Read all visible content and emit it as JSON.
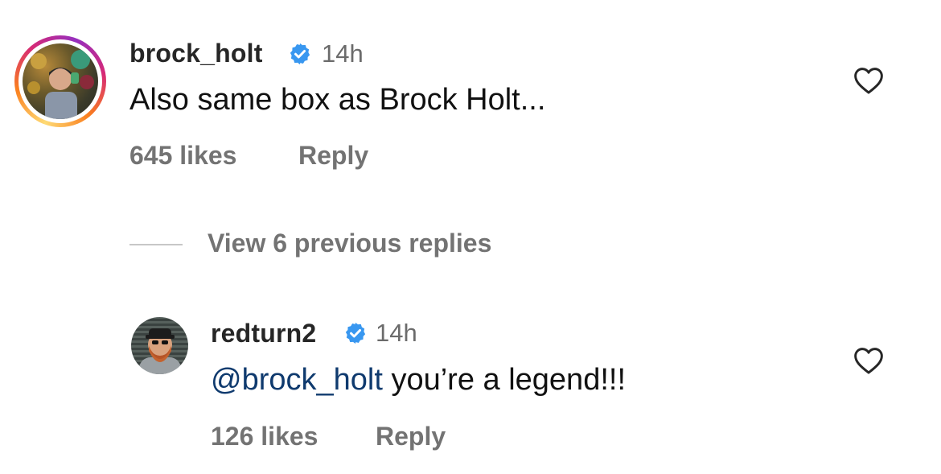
{
  "comments": [
    {
      "username": "brock_holt",
      "verified": true,
      "time": "14h",
      "text": "Also same box as Brock Holt...",
      "likes": "645 likes",
      "reply_label": "Reply",
      "avatar_ring": true
    },
    {
      "username": "redturn2",
      "verified": true,
      "time": "14h",
      "mention": "@brock_holt",
      "text": " you’re a legend!!!",
      "likes": "126 likes",
      "reply_label": "Reply",
      "avatar_ring": false
    }
  ],
  "thread": {
    "view_replies_label": "View 6 previous replies"
  },
  "icons": {
    "verified": "verified-badge-icon",
    "like": "heart-outline-icon"
  },
  "colors": {
    "verified_blue": "#3897f0",
    "mention": "#0f3a6e",
    "secondary_text": "#737373"
  }
}
